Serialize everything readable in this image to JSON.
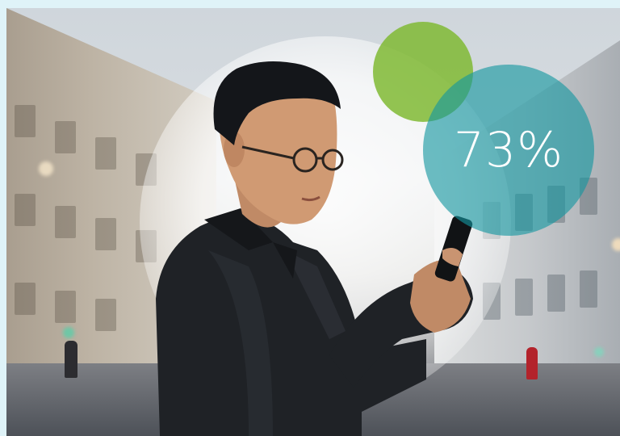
{
  "stat": {
    "value": "73%"
  },
  "colors": {
    "frame_background": "#dff3f8",
    "green_circle": "#80ba34",
    "teal_circle": "#1496a0",
    "stat_text": "#ffffff"
  },
  "icons": []
}
